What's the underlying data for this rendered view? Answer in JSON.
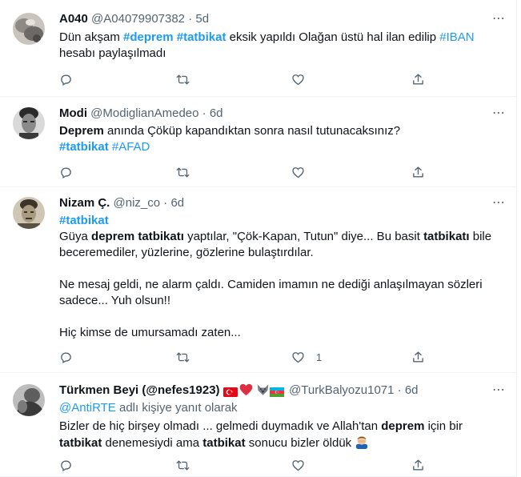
{
  "tweets": [
    {
      "name": "A040",
      "handle": "@A04079907382",
      "time": "5d",
      "lines": [
        [
          [
            "Dün akşam ",
            "t"
          ],
          [
            "#deprem",
            "tb"
          ],
          [
            " ",
            "t"
          ],
          [
            "#tatbikat",
            "tb"
          ],
          [
            " eksik yapıldı Olağan üstü hal ilan edilip ",
            "t"
          ],
          [
            "#IBAN",
            "tg"
          ]
        ],
        [
          [
            "hesabı paylaşılmadı",
            "t"
          ]
        ]
      ],
      "like_count": ""
    },
    {
      "name": "Modi",
      "handle": "@ModiglianAmedeo",
      "time": "6d",
      "lines": [
        [
          [
            "Deprem",
            "b"
          ],
          [
            " anında Çöküp kapandıktan sonra nasıl tutunacaksınız?",
            "t"
          ]
        ],
        [
          [
            "#tatbikat",
            "tb"
          ],
          [
            " ",
            "t"
          ],
          [
            "#AFAD",
            "tg"
          ]
        ]
      ],
      "like_count": ""
    },
    {
      "name": "Nizam Ç.",
      "handle": "@niz_co",
      "time": "6d",
      "lines": [
        [
          [
            "#tatbikat",
            "tb"
          ]
        ],
        [
          [
            "Güya ",
            "t"
          ],
          [
            "deprem tatbikatı",
            "b"
          ],
          [
            " yaptılar, \"Çök-Kapan, Tutun\" diye... Bu basit ",
            "t"
          ],
          [
            "tatbikatı",
            "b"
          ],
          [
            " bile",
            "t"
          ]
        ],
        [
          [
            "beceremediler, yüzlerine, gözlerine bulaştırdılar.",
            "t"
          ]
        ],
        [],
        [
          [
            "Ne mesaj geldi, ne alarm çaldı. Camiden imamın ne dediği anlaşılmayan sözleri",
            "t"
          ]
        ],
        [
          [
            "sadece... Yuh olsun!!",
            "t"
          ]
        ],
        [],
        [
          [
            "Hiç kimse de umursamadı zaten...",
            "t"
          ]
        ]
      ],
      "like_count": "1"
    },
    {
      "name": "Türkmen Beyi (@nefes1923)",
      "handle": "@TurkBalyozu1071",
      "time": "6d",
      "replying_to_handle": "@AntiRTE",
      "replying_suffix": " adlı kişiye yanıt olarak",
      "lines": [
        [
          [
            "Bizler de hiç birşey olmadı ... gelmedi duymadık ve Allah'tan ",
            "t"
          ],
          [
            "deprem",
            "b"
          ],
          [
            " için bir",
            "t"
          ]
        ],
        [
          [
            "tatbikat",
            "b"
          ],
          [
            " denemesiydi ama ",
            "t"
          ],
          [
            "tatbikat",
            "b"
          ],
          [
            " sonucu bizler öldük ",
            "t"
          ]
        ]
      ],
      "like_count": ""
    }
  ],
  "icons": {
    "reply": "reply-icon",
    "retweet": "retweet-icon",
    "like": "like-icon",
    "share": "share-icon",
    "more": "more-icon",
    "name_emojis": [
      "turkey-flag-icon",
      "red-heart-icon",
      "wolf-icon",
      "azerbaijan-flag-icon"
    ],
    "facepalm": "man-facepalming-icon"
  },
  "colors": {
    "accent": "#1d9bf0",
    "text": "#0f1419",
    "muted": "#536471",
    "divider": "#eff3f4"
  },
  "ui": {
    "dot": "·",
    "more_glyph": "⋯"
  }
}
